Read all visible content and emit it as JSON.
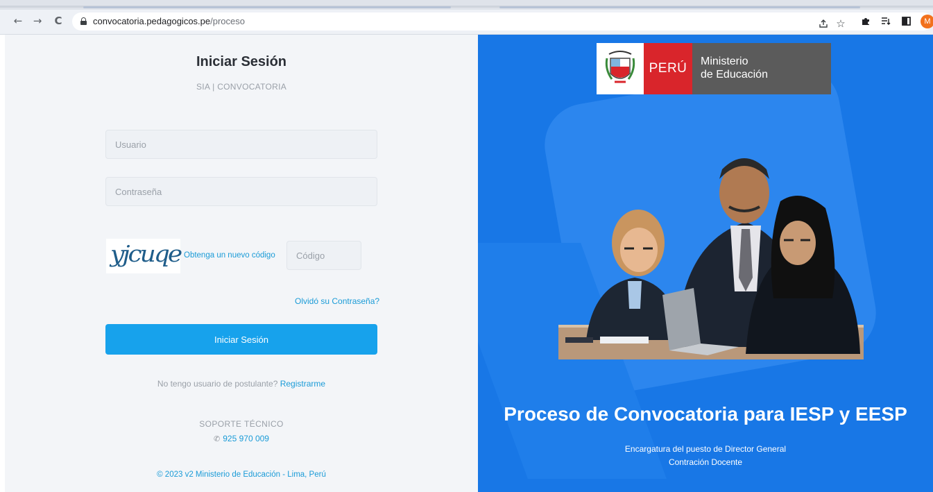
{
  "browser": {
    "url_host": "convocatoria.pedagogicos.pe",
    "url_path": "/proceso",
    "nav_back": "←",
    "nav_forward": "→",
    "nav_reload": "C",
    "icons": [
      "back-icon",
      "forward-icon",
      "reload-icon",
      "lock-icon",
      "share-icon",
      "star-icon",
      "extensions-icon",
      "reading-list-icon",
      "side-panel-icon",
      "profile-avatar"
    ],
    "avatar_letter": "M",
    "avatar_color": "#f2711c"
  },
  "login": {
    "title": "Iniciar Sesión",
    "subtitle": "SIA | CONVOCATORIA",
    "username_placeholder": "Usuario",
    "password_placeholder": "Contraseña",
    "captcha_text": "yjcuqe",
    "captcha_refresh_label": "Obtenga un nuevo código",
    "code_placeholder": "Código",
    "forgot_label": "Olvidó su Contraseña?",
    "submit_label": "Iniciar Sesión",
    "register_prompt": "No tengo usuario de postulante?",
    "register_link": "Registrarme",
    "support_title": "SOPORTE TÉCNICO",
    "support_phone": "925 970 009",
    "copyright": "© 2023 v2 Ministerio de Educación - Lima, Perú",
    "accent_color": "#17a2ec"
  },
  "hero": {
    "logo_country": "PERÚ",
    "logo_ministry_line1": "Ministerio",
    "logo_ministry_line2": "de Educación",
    "title": "Proceso de Convocatoria para IESP y EESP",
    "subtitle_line1": "Encargatura del puesto de Director General",
    "subtitle_line2": "Contración Docente",
    "background_color": "#1877e6"
  }
}
